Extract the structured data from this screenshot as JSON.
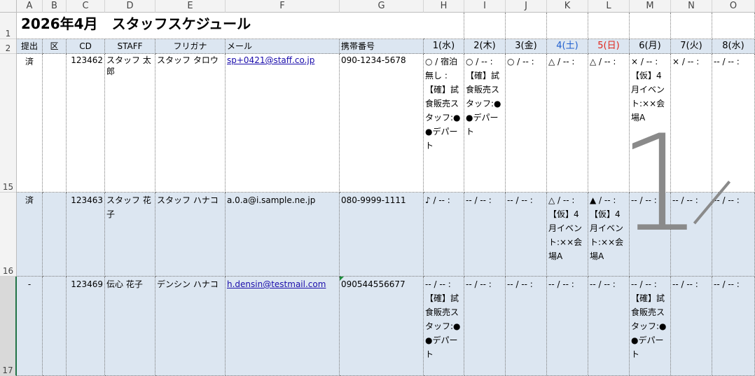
{
  "column_headers": [
    "A",
    "B",
    "C",
    "D",
    "E",
    "F",
    "G",
    "H",
    "I",
    "J",
    "K",
    "L",
    "M",
    "N",
    "O"
  ],
  "row_headers": [
    "1",
    "2",
    "15",
    "16",
    "17"
  ],
  "title": "2026年4月　スタッフスケジュール",
  "table_headers": [
    "提出",
    "区",
    "CD",
    "STAFF",
    "フリガナ",
    "メール",
    "携帯番号",
    "1(水)",
    "2(木)",
    "3(金)",
    "4(土)",
    "5(日)",
    "6(月)",
    "7(火)",
    "8(水)"
  ],
  "rows": [
    {
      "submitted": "済",
      "ku": "",
      "cd": "123462",
      "staff": "スタッフ 太郎",
      "furigana": "スタッフ タロウ",
      "email": "sp+0421@staff.co.jp",
      "phone": "090-1234-5678",
      "days": [
        "○ / 宿泊無し : 【確】試食販売スタッフ:●●デパート",
        "○ / -- : 【確】試食販売スタッフ:●●デパート",
        "○ / -- :",
        "△ / -- :",
        "△ / -- :",
        "× / -- : 【仮】4月イベント:××会場A",
        "× / -- :",
        "-- / -- :"
      ]
    },
    {
      "submitted": "済",
      "ku": "",
      "cd": "123463",
      "staff": "スタッフ 花子",
      "furigana": "スタッフ ハナコ",
      "email": "a.0.a@i.sample.ne.jp",
      "phone": "080-9999-1111",
      "days": [
        "♪ / -- :",
        "-- / -- :",
        "-- / -- :",
        "△ / -- : 【仮】4月イベント:××会場A",
        "▲ / -- : 【仮】4月イベント:××会場A",
        "-- / -- :",
        "-- / -- :",
        "-- / -- :"
      ]
    },
    {
      "submitted": "-",
      "ku": "",
      "cd": "123469",
      "staff": "伝心 花子",
      "furigana": "デンシン ハナコ",
      "email": "h.densin@testmail.com",
      "phone": "090544556677",
      "days": [
        "-- / -- : 【確】試食販売スタッフ:●●デパート",
        "-- / -- :",
        "-- / -- :",
        "-- / -- :",
        "-- / -- :",
        "-- / -- : 【確】試食販売スタッフ:●●デパート",
        "-- / -- :",
        "-- / -- :"
      ]
    }
  ],
  "watermark": "1"
}
